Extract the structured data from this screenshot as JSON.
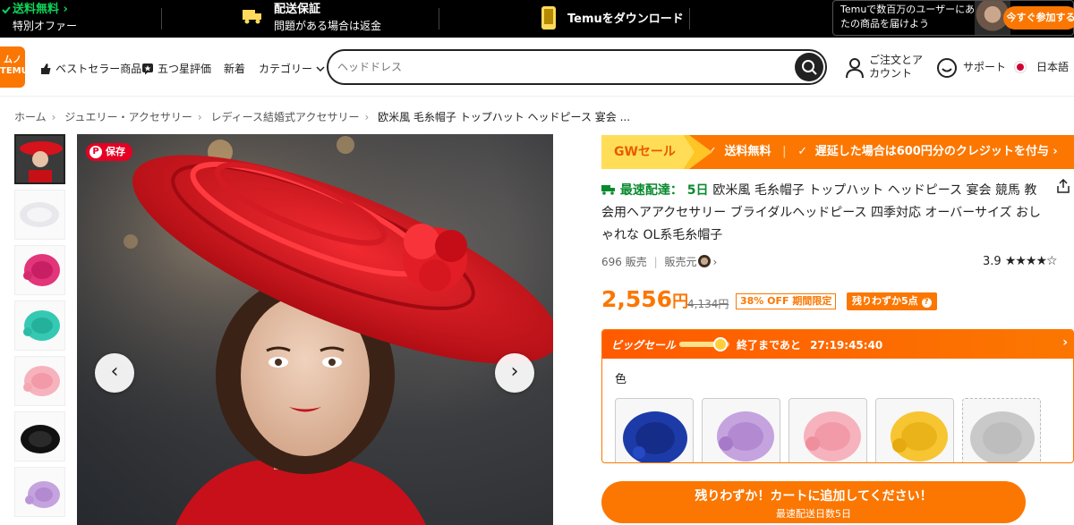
{
  "promo": {
    "free_shipping": "送料無料",
    "special_offer": "特別オファー",
    "delivery_title": "配送保証",
    "delivery_sub": "問題がある場合は返金",
    "download": "Temuをダウンロード",
    "app_text_1": "Temuで数百万のユーザーにあな",
    "app_text_2": "たの商品を届けよう",
    "join_button": "今すぐ参加する"
  },
  "header": {
    "logo_line1": "ムノ",
    "logo_line2": "TEMU",
    "nav_bestseller": "ベストセラー商品",
    "nav_fivestar": "五つ星評価",
    "nav_new": "新着",
    "nav_category": "カテゴリー",
    "search_placeholder": "ヘッドドレス",
    "orders_line1": "ご注文とア",
    "orders_line2": "カウント",
    "support": "サポート",
    "language": "日本語"
  },
  "breadcrumb": [
    "ホーム",
    "ジュエリー・アクセサリー",
    "レディース結婚式アクセサリー",
    "欧米風 毛糸帽子 トップハット ヘッドピース 宴会 ..."
  ],
  "gallery": {
    "save_label": "保存",
    "prev": "‹",
    "next": "›"
  },
  "product": {
    "gw_tag": "GWセール",
    "gw_free": "送料無料",
    "gw_credit": "遅延した場合は600円分のクレジットを付与",
    "fast_label": "最速配達： 5日",
    "title": "欧米風 毛糸帽子 トップハット ヘッドピース 宴会 競馬 教会用ヘアアクセサリー ブライダルヘッドピース 四季対応 オーバーサイズ おしゃれな OL系毛糸帽子",
    "sold": "696 販売",
    "seller": "販売元",
    "rating_value": "3.9",
    "rating_stars": "★★★★☆",
    "price": "2,556",
    "price_unit": "円",
    "old_price": "4,134円",
    "discount": "38% OFF 期間限定",
    "stock": "残りわずか5点"
  },
  "bigsale": {
    "label": "ビッグセール",
    "ends_label": "終了まであと",
    "countdown": "27:19:45:40",
    "color_label": "色",
    "progress_fraction": 0.74
  },
  "cta": {
    "label": "残りわずか！カートに追加してください！",
    "sub": "最速配送日数5日"
  },
  "colors": {
    "accent": "#fb7701",
    "green": "#0fd45a",
    "hat_red": "#d6121d"
  }
}
